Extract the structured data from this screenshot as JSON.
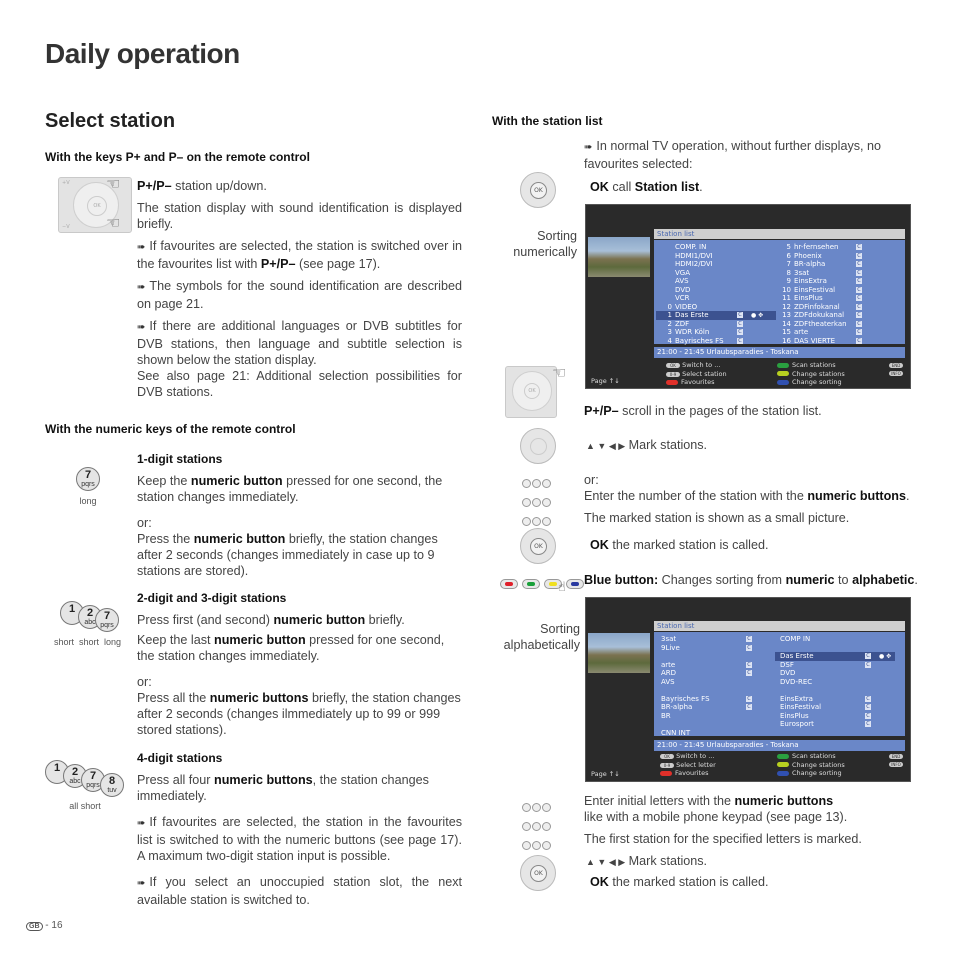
{
  "page_title": "Daily operation",
  "section_title": "Select station",
  "left": {
    "keys_heading": "With the keys P+ and P– on the remote control",
    "pp_label": "P+/P–",
    "pp_text": " station up/down.",
    "p1": "The station display with sound identification is displayed briefly.",
    "p2a": "If favourites are selected, the station is switched over in the favourites list with ",
    "p2b": "P+/P–",
    "p2c": " (see page 17).",
    "p3": "The symbols for the sound identification are described on page 21.",
    "p4": "If there are additional languages or DVB subtitles for DVB stations, then language and subtitle selection is shown below the station display.",
    "p5": "See also page 21: Additional selection possibilities for DVB stations.",
    "numeric_heading": "With the numeric keys of the remote control",
    "d1": {
      "title": "1-digit stations",
      "a1": "Keep the ",
      "a2": "numeric button",
      "a3": " pressed for one second, the station changes immediately.",
      "or": "or:",
      "b1": "Press the ",
      "b2": "numeric button",
      "b3": " briefly, the station changes after 2 seconds (changes immediately in case up to 9 stations are stored).",
      "caption": "long",
      "key": {
        "digit": "7",
        "letters": "pqrs"
      }
    },
    "d2": {
      "title": "2-digit and 3-digit stations",
      "a1": "Press first (and second) ",
      "a2": "numeric button",
      "a3": " briefly.",
      "b1": "Keep the last ",
      "b2": "numeric button",
      "b3": " pressed for one second, the station changes immediately.",
      "or": "or:",
      "c1": "Press all the ",
      "c2": "numeric buttons",
      "c3": " briefly, the station changes after 2 seconds (changes ilmmediately up to 99 or 999 stored stations).",
      "caption": "short  short  long",
      "keys": [
        {
          "digit": "1",
          "letters": ""
        },
        {
          "digit": "2",
          "letters": "abc"
        },
        {
          "digit": "7",
          "letters": "pqrs"
        }
      ]
    },
    "d4": {
      "title": "4-digit stations",
      "a1": "Press all four ",
      "a2": "numeric buttons",
      "a3": ", the station changes immediately.",
      "n1": "If favourites are selected, the station in the favourites list is switched to with the numeric buttons (see page 17). A maximum two-digit station input is possible.",
      "n2": "If you select an unoccupied station slot, the next available station is switched to.",
      "caption": "all short",
      "keys": [
        {
          "digit": "1",
          "letters": ""
        },
        {
          "digit": "2",
          "letters": "abc"
        },
        {
          "digit": "7",
          "letters": "pqrs"
        },
        {
          "digit": "8",
          "letters": "tuv"
        }
      ]
    }
  },
  "right": {
    "heading": "With the station list",
    "intro": "In normal TV operation, without further displays, no favourites selected:",
    "ok_label": "OK",
    "ok_call": " call ",
    "ok_station_list": "Station list",
    "sorting_num": "Sorting numerically",
    "sorting_alpha": "Sorting alphabetically",
    "pp_label": "P+/P–",
    "pp_text": " scroll in the pages of the station list.",
    "arrows": "▲ ▼ ◀ ▶",
    "mark": " Mark stations.",
    "or": "or:",
    "enter1": "Enter the number of the station with the ",
    "enter2": "numeric buttons",
    "enter3": ".",
    "marked_small": "The marked station is shown as a small picture.",
    "ok_called": " the marked station is called.",
    "blue1": "Blue button:",
    "blue2": " Changes sorting from ",
    "blue3": "numeric",
    "blue4": " to ",
    "blue5": "alphabetic",
    "blue6": ".",
    "initial1": "Enter initial letters with the ",
    "initial2": "numeric buttons",
    "initial3": "like with a mobile phone keypad (see page 13).",
    "initial4": "The first station for the specified letters is marked.",
    "mark2": " Mark stations.",
    "ok_called2": " the marked station is called.",
    "color_buttons": {
      "red": "#e0202a",
      "green": "#1aa03a",
      "yellow": "#f0e020",
      "blue": "#2a3aa0"
    }
  },
  "tv_numeric": {
    "header": "Station list",
    "left_col": [
      {
        "num": "",
        "name": "COMP. IN",
        "ci": false
      },
      {
        "num": "",
        "name": "HDMI1/DVI",
        "ci": false
      },
      {
        "num": "",
        "name": "HDMI2/DVI",
        "ci": false
      },
      {
        "num": "",
        "name": "VGA",
        "ci": false
      },
      {
        "num": "",
        "name": "AVS",
        "ci": false
      },
      {
        "num": "",
        "name": "DVD",
        "ci": false
      },
      {
        "num": "",
        "name": "VCR",
        "ci": false
      },
      {
        "num": "0",
        "name": "VIDEO",
        "ci": false
      },
      {
        "num": "1",
        "name": "Das Erste",
        "ci": true,
        "selected": true
      },
      {
        "num": "2",
        "name": "ZDF",
        "ci": true
      },
      {
        "num": "3",
        "name": "WDR Köln",
        "ci": true
      },
      {
        "num": "4",
        "name": "Bayrisches FS",
        "ci": true
      }
    ],
    "right_col": [
      {
        "num": "5",
        "name": "hr-fernsehen",
        "ci": true
      },
      {
        "num": "6",
        "name": "Phoenix",
        "ci": true
      },
      {
        "num": "7",
        "name": "BR-alpha",
        "ci": true
      },
      {
        "num": "8",
        "name": "3sat",
        "ci": true
      },
      {
        "num": "9",
        "name": "EinsExtra",
        "ci": true
      },
      {
        "num": "10",
        "name": "EinsFestival",
        "ci": true
      },
      {
        "num": "11",
        "name": "EinsPlus",
        "ci": true
      },
      {
        "num": "12",
        "name": "ZDFinfokanal",
        "ci": true
      },
      {
        "num": "13",
        "name": "ZDFdokukanal",
        "ci": true
      },
      {
        "num": "14",
        "name": "ZDFtheaterkan",
        "ci": true
      },
      {
        "num": "15",
        "name": "arte",
        "ci": true
      },
      {
        "num": "16",
        "name": "DAS VIERTE",
        "ci": true
      }
    ],
    "epg": "21:00 - 21:45  Urlaubsparadies - Toskana",
    "footer": {
      "page": "Page ↑↓",
      "switch_to": "Switch to ...",
      "select": "Select station",
      "favourites": "Favourites",
      "scan": "Scan stations",
      "change_stations": "Change stations",
      "change_sorting": "Change sorting",
      "key_end": "END",
      "key_info": "INFO"
    }
  },
  "tv_alpha": {
    "header": "Station list",
    "left_col": [
      {
        "name": "3sat",
        "ci": true
      },
      {
        "name": "9Live",
        "ci": true
      },
      {
        "name": "",
        "ci": false
      },
      {
        "name": "arte",
        "ci": true
      },
      {
        "name": "ARD",
        "ci": true
      },
      {
        "name": "AVS",
        "ci": false
      },
      {
        "name": "",
        "ci": false
      },
      {
        "name": "Bayrisches FS",
        "ci": true
      },
      {
        "name": "BR-alpha",
        "ci": true
      },
      {
        "name": "BR",
        "ci": false
      },
      {
        "name": "",
        "ci": false
      },
      {
        "name": "CNN INT",
        "ci": false
      }
    ],
    "right_col": [
      {
        "name": "COMP IN",
        "ci": false
      },
      {
        "name": "",
        "ci": false
      },
      {
        "name": "Das Erste",
        "ci": true,
        "selected": true
      },
      {
        "name": "DSF",
        "ci": true
      },
      {
        "name": "DVD",
        "ci": false
      },
      {
        "name": "DVD-REC",
        "ci": false
      },
      {
        "name": "",
        "ci": false
      },
      {
        "name": "EinsExtra",
        "ci": true
      },
      {
        "name": "EinsFestival",
        "ci": true
      },
      {
        "name": "EinsPlus",
        "ci": true
      },
      {
        "name": "Eurosport",
        "ci": true
      },
      {
        "name": "",
        "ci": false
      }
    ],
    "epg": "21:00 - 21:45  Urlaubsparadies - Toskana",
    "footer": {
      "page": "Page ↑↓",
      "switch_to": "Switch to ...",
      "select": "Select letter",
      "favourites": "Favourites",
      "scan": "Scan stations",
      "change_stations": "Change stations",
      "change_sorting": "Change sorting",
      "key_end": "END",
      "key_info": "INFO"
    }
  },
  "footer": {
    "country": "GB",
    "page": " - 16"
  }
}
